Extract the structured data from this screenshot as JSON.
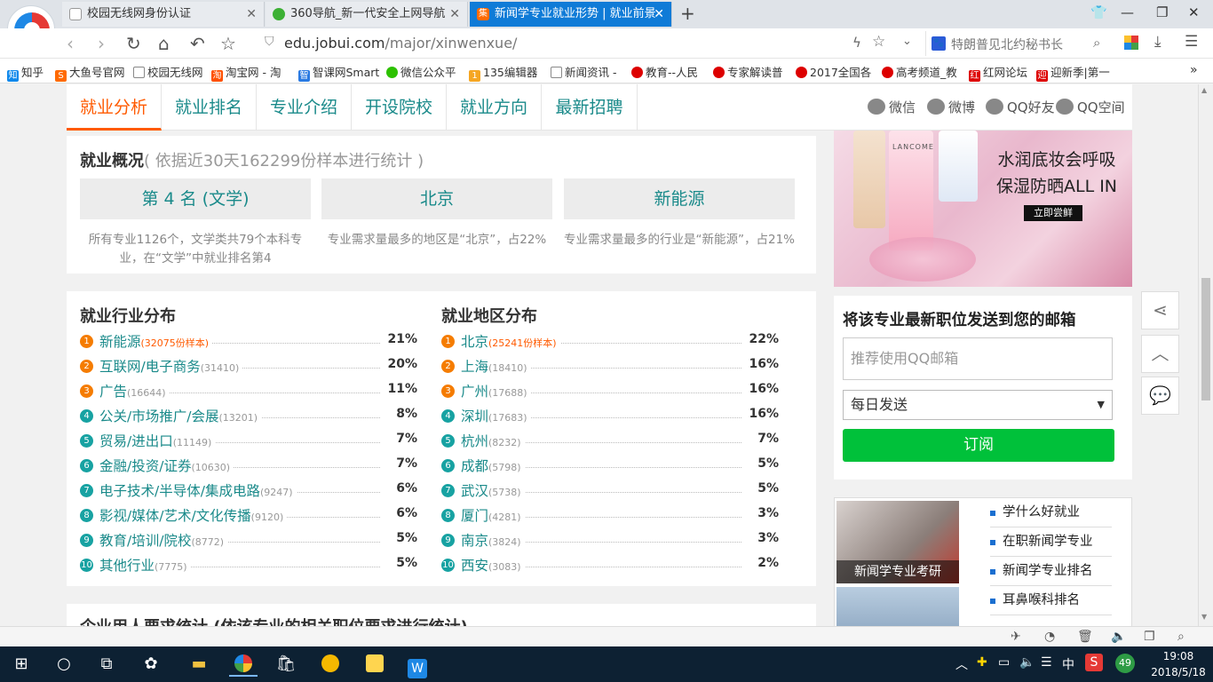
{
  "browser": {
    "tabs": [
      {
        "title": "校园无线网身份认证",
        "active": false
      },
      {
        "title": "360导航_新一代安全上网导航",
        "active": false
      },
      {
        "title": "新闻学专业就业形势 | 就业前景",
        "active": true
      }
    ],
    "new_tab": "+",
    "address": {
      "domain": "edu.jobui.com",
      "path": "/major/xinwenxue/"
    },
    "search_text": "特朗普见北约秘书长",
    "bookmarks": [
      "知乎",
      "大鱼号官网",
      "校园无线网",
      "淘宝网 - 淘",
      "智课网Smart",
      "微信公众平",
      "135编辑器",
      "新闻资讯 -",
      "教育--人民",
      "专家解读普",
      "2017全国各",
      "高考频道_教",
      "红网论坛",
      "迎新季|第一"
    ],
    "bookmark_more": "»"
  },
  "page": {
    "nav": [
      "就业分析",
      "就业排名",
      "专业介绍",
      "开设院校",
      "就业方向",
      "最新招聘"
    ],
    "share": [
      "微信",
      "微博",
      "QQ好友",
      "QQ空间"
    ],
    "overview": {
      "title": "就业概况",
      "subtitle": "( 依据近30天162299份样本进行统计 )",
      "boxes": [
        {
          "value": "第 4 名 (文学)",
          "desc": "所有专业1126个，文学类共79个本科专业，在“文学”中就业排名第4"
        },
        {
          "value": "北京",
          "desc": "专业需求量最多的地区是“北京”，占22%"
        },
        {
          "value": "新能源",
          "desc": "专业需求量最多的行业是“新能源”，占21%"
        }
      ]
    },
    "industry": {
      "title": "就业行业分布",
      "rows": [
        {
          "n": "1",
          "name": "新能源",
          "count": "(32075份样本)",
          "pct": "21%"
        },
        {
          "n": "2",
          "name": "互联网/电子商务",
          "count": "(31410)",
          "pct": "20%"
        },
        {
          "n": "3",
          "name": "广告",
          "count": "(16644)",
          "pct": "11%"
        },
        {
          "n": "4",
          "name": "公关/市场推广/会展",
          "count": "(13201)",
          "pct": "8%"
        },
        {
          "n": "5",
          "name": "贸易/进出口",
          "count": "(11149)",
          "pct": "7%"
        },
        {
          "n": "6",
          "name": "金融/投资/证券",
          "count": "(10630)",
          "pct": "7%"
        },
        {
          "n": "7",
          "name": "电子技术/半导体/集成电路",
          "count": "(9247)",
          "pct": "6%"
        },
        {
          "n": "8",
          "name": "影视/媒体/艺术/文化传播",
          "count": "(9120)",
          "pct": "6%"
        },
        {
          "n": "9",
          "name": "教育/培训/院校",
          "count": "(8772)",
          "pct": "5%"
        },
        {
          "n": "10",
          "name": "其他行业",
          "count": "(7775)",
          "pct": "5%"
        }
      ]
    },
    "region": {
      "title": "就业地区分布",
      "rows": [
        {
          "n": "1",
          "name": "北京",
          "count": "(25241份样本)",
          "pct": "22%"
        },
        {
          "n": "2",
          "name": "上海",
          "count": "(18410)",
          "pct": "16%"
        },
        {
          "n": "3",
          "name": "广州",
          "count": "(17688)",
          "pct": "16%"
        },
        {
          "n": "4",
          "name": "深圳",
          "count": "(17683)",
          "pct": "16%"
        },
        {
          "n": "5",
          "name": "杭州",
          "count": "(8232)",
          "pct": "7%"
        },
        {
          "n": "6",
          "name": "成都",
          "count": "(5798)",
          "pct": "5%"
        },
        {
          "n": "7",
          "name": "武汉",
          "count": "(5738)",
          "pct": "5%"
        },
        {
          "n": "8",
          "name": "厦门",
          "count": "(4281)",
          "pct": "3%"
        },
        {
          "n": "9",
          "name": "南京",
          "count": "(3824)",
          "pct": "3%"
        },
        {
          "n": "10",
          "name": "西安",
          "count": "(3083)",
          "pct": "2%"
        }
      ]
    },
    "next_section": "企业用人要求统计 (依该专业的相关职位要求进行统计)",
    "ad": {
      "line1": "水润底妆会呼吸",
      "line2": "保湿防晒ALL IN",
      "button": "立即尝鲜",
      "brand": "LANCOME"
    },
    "subscribe": {
      "title": "将该专业最新职位发送到您的邮箱",
      "placeholder": "推荐使用QQ邮箱",
      "frequency": "每日发送",
      "button": "订阅"
    },
    "related": {
      "image_caption": "新闻学专业考研",
      "links": [
        "学什么好就业",
        "在职新闻学专业",
        "新闻学专业排名",
        "耳鼻喉科排名"
      ]
    }
  },
  "taskbar": {
    "time": "19:08",
    "date": "2018/5/18",
    "ime": "中",
    "badge": "49"
  }
}
